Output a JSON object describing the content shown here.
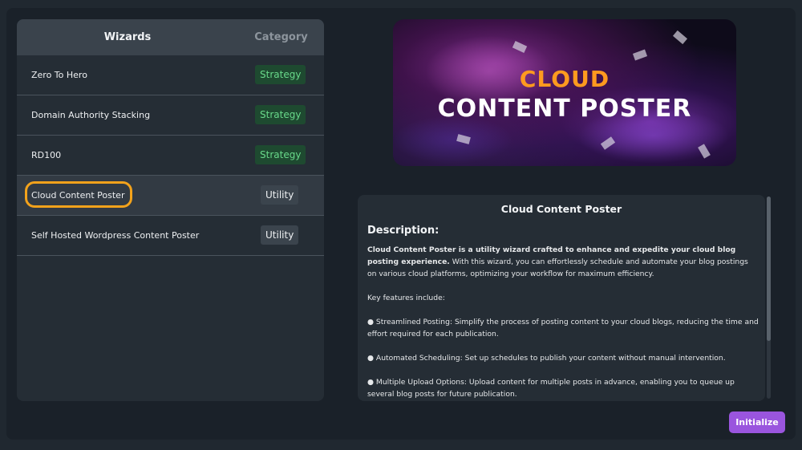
{
  "table": {
    "header_wizards": "Wizards",
    "header_category": "Category",
    "rows": [
      {
        "name": "Zero To Hero",
        "category": "Strategy"
      },
      {
        "name": "Domain Authority Stacking",
        "category": "Strategy"
      },
      {
        "name": "RD100",
        "category": "Strategy"
      },
      {
        "name": "Cloud Content Poster",
        "category": "Utility"
      },
      {
        "name": "Self Hosted Wordpress Content Poster",
        "category": "Utility"
      }
    ]
  },
  "banner": {
    "line1": "CLOUD",
    "line2": "CONTENT POSTER"
  },
  "description": {
    "title": "Cloud Content Poster",
    "heading": "Description:",
    "intro_bold": "Cloud Content Poster is a utility wizard crafted to enhance and expedite your cloud blog posting experience.",
    "intro_rest": "With this wizard, you can effortlessly schedule and automate your blog postings on various cloud platforms, optimizing your workflow for maximum efficiency.",
    "features_label": "Key features include:",
    "feature1": "● Streamlined Posting: Simplify the process of posting content to your cloud blogs, reducing the time and effort required for each publication.",
    "feature2": "● Automated Scheduling: Set up schedules to publish your content without manual intervention.",
    "feature3": "● Multiple Upload Options: Upload content for multiple posts in advance, enabling you to queue up several blog posts for future publication."
  },
  "actions": {
    "initialize_label": "Initialize"
  },
  "colors": {
    "accent_purple": "#9a55de",
    "strategy_green": "#68d98a",
    "highlight_orange": "#f3a21b",
    "banner_orange": "#ff9a1f"
  }
}
